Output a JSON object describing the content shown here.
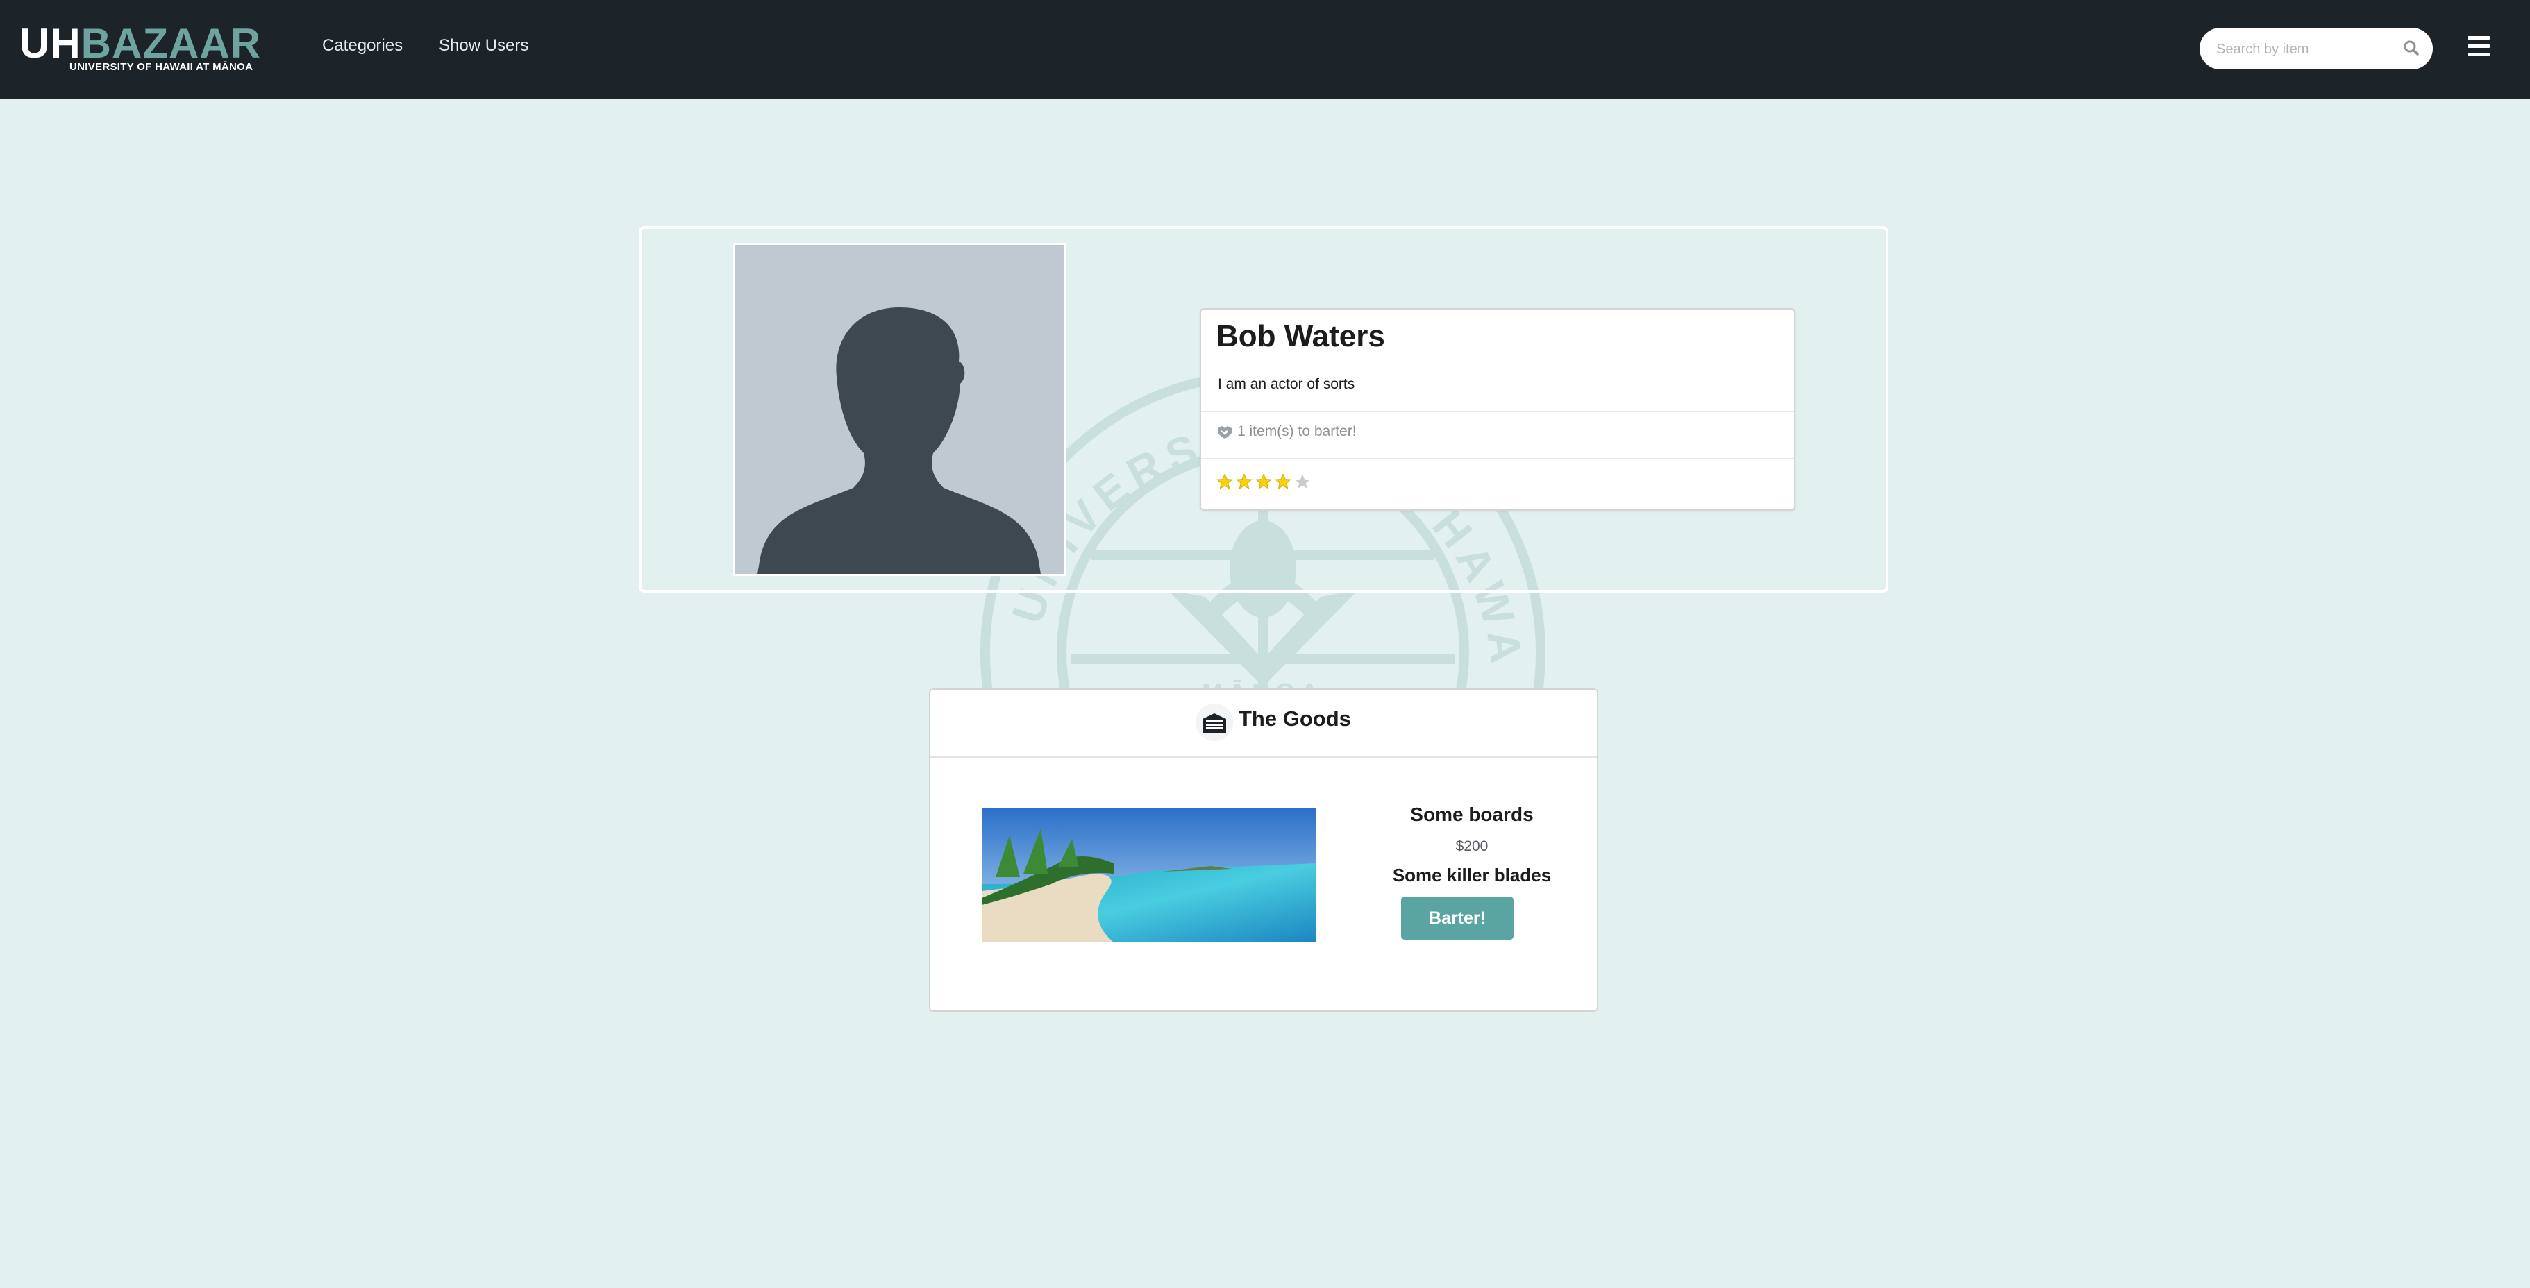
{
  "navbar": {
    "logo_main_uh": "UH",
    "logo_main_bazaar": "BAZAAR",
    "logo_sub": "UNIVERSITY OF HAWAII AT MĀNOA",
    "links": [
      "Categories",
      "Show Users"
    ],
    "search_placeholder": "Search by item",
    "icons": {
      "search": "search-icon",
      "menu": "hamburger-menu-icon"
    }
  },
  "watermark": {
    "seal_text_left": "UNIVERSITY",
    "seal_text_right": "OF HAWAII",
    "seal_text_bottom": "MĀNOA"
  },
  "profile": {
    "name": "Bob Waters",
    "bio": "I am an actor of sorts",
    "items_to_barter": "1 item(s) to barter!",
    "rating": 4,
    "rating_max": 5
  },
  "goods": {
    "title": "The Goods",
    "items": [
      {
        "name": "Some boards",
        "price": "$200",
        "description": "Some killer blades",
        "button_label": "Barter!"
      }
    ]
  },
  "colors": {
    "background": "#e2f0ef",
    "navbar": "#1c2329",
    "accent": "#5aa5a1",
    "star": "#fbd208"
  }
}
